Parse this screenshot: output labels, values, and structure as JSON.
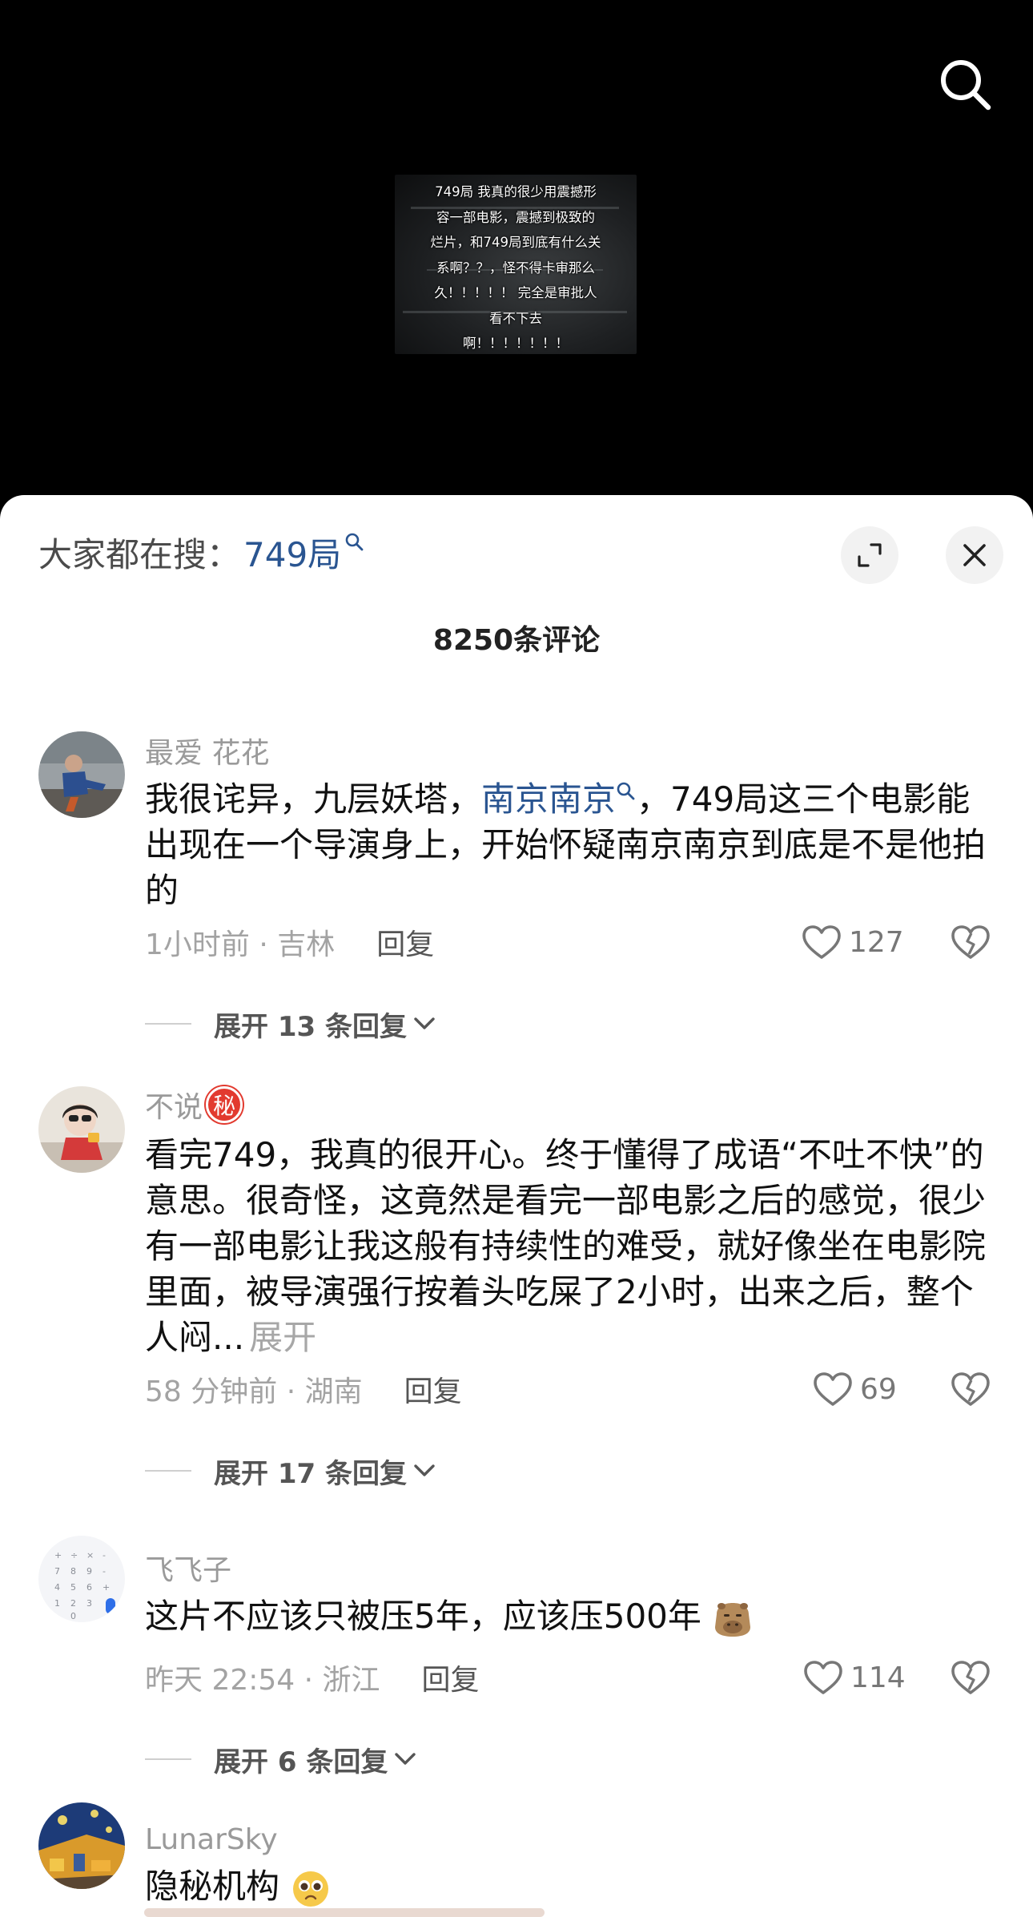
{
  "video": {
    "caption": "749局 我真的很少用震撼形\n容一部电影，震撼到极致的\n烂片，和749局到底有什么关\n系啊？？，怪不得卡审那么\n久！！！！！ 完全是审批人\n看不下去\n啊！！！！！！！"
  },
  "sheet": {
    "hot_search_prefix": "大家都在搜：",
    "hot_search_term": "749局",
    "comment_count": "8250条评论"
  },
  "comments": [
    {
      "username": "最爱 花花",
      "text_before": "我很诧异，九层妖塔，",
      "link": "南京南京",
      "text_after": "，749局这三个电影能出现在一个导演身上，开始怀疑南京南京到底是不是他拍的",
      "time_location": "1小时前 · 吉林",
      "reply_label": "回复",
      "likes": "127",
      "expand_label": "展开 13 条回复"
    },
    {
      "username": "不说",
      "badge": "秘",
      "text": "看完749，我真的很开心。终于懂得了成语“不吐不快”的意思。很奇怪，这竟然是看完一部电影之后的感觉，很少有一部电影让我这般有持续性的难受，就好像坐在电影院里面，被导演强行按着头吃屎了2小时，出来之后，整个人闷...",
      "more_label": "展开",
      "time_location": "58 分钟前 · 湖南",
      "reply_label": "回复",
      "likes": "69",
      "expand_label": "展开 17 条回复"
    },
    {
      "username": "飞飞子",
      "text": "这片不应该只被压5年，应该压500年",
      "time_location": "昨天 22:54 · 浙江",
      "reply_label": "回复",
      "likes": "114",
      "expand_label": "展开 6 条回复"
    },
    {
      "username": "LunarSky",
      "text": "隐秘机构"
    }
  ],
  "colors": {
    "link": "#2a5591",
    "secret_badge": "#e23a2f"
  }
}
